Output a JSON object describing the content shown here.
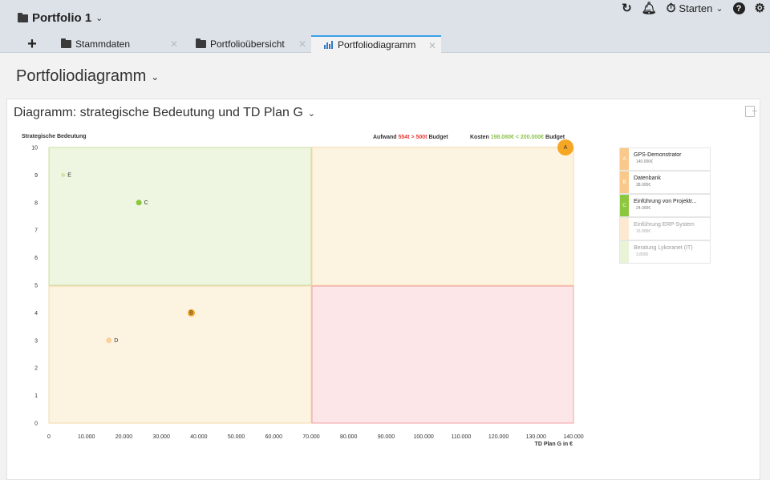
{
  "header": {
    "portfolio_title": "Portfolio 1",
    "starten_label": "Starten",
    "icons": [
      "refresh-icon",
      "bell-icon",
      "stopwatch-icon",
      "help-icon",
      "gear-icon"
    ]
  },
  "tabs": [
    {
      "label": "Stammdaten",
      "icon": "folder-icon",
      "active": false
    },
    {
      "label": "Portfolioübersicht",
      "icon": "folder-icon",
      "active": false
    },
    {
      "label": "Portfoliodiagramm",
      "icon": "chart-icon",
      "active": true
    }
  ],
  "page": {
    "title": "Portfoliodiagramm"
  },
  "card": {
    "title": "Diagramm: strategische Bedeutung und TD Plan G"
  },
  "budget": {
    "aufwand_label": "Aufwand",
    "aufwand_value": "554t > 500t",
    "aufwand_suffix": "Budget",
    "kosten_label": "Kosten",
    "kosten_value": "198.080€ < 200.000€",
    "kosten_suffix": "Budget",
    "colors": {
      "over": "#e53935",
      "under": "#8bc34a"
    }
  },
  "chart_data": {
    "type": "scatter",
    "xlabel": "TD Plan G in €",
    "ylabel": "Strategische Bedeutung",
    "xlim": [
      0,
      140000
    ],
    "ylim": [
      0,
      10
    ],
    "x_ticks": [
      "0",
      "10.000",
      "20.000",
      "30.000",
      "40.000",
      "50.000",
      "60.000",
      "70.000",
      "80.000",
      "90.000",
      "100.000",
      "110.000",
      "120.000",
      "130.000",
      "140.000"
    ],
    "y_ticks": [
      "0",
      "1",
      "2",
      "3",
      "4",
      "5",
      "6",
      "7",
      "8",
      "9",
      "10"
    ],
    "quadrants": [
      {
        "name": "top-left",
        "color": "#eef5e0",
        "border": "#c9dfa6"
      },
      {
        "name": "top-right",
        "color": "#fdf3e1",
        "border": "#f5d9a8"
      },
      {
        "name": "bottom-left",
        "color": "#fdf3e1",
        "border": "#f5d9a8"
      },
      {
        "name": "bottom-right",
        "color": "#fde6e7",
        "border": "#f0a0a6"
      }
    ],
    "points": [
      {
        "x": 140000,
        "y": 10,
        "label": "A",
        "color": "#f5a623",
        "size": "large"
      },
      {
        "x": 38000,
        "y": 4,
        "label": "B",
        "color": "#f5a623",
        "size": "medium"
      },
      {
        "x": 24000,
        "y": 8,
        "label": "C",
        "color": "#8dc63f",
        "size": "small"
      },
      {
        "x": 16000,
        "y": 3,
        "label": "D",
        "color": "#f8d19b",
        "size": "small"
      },
      {
        "x": 3800,
        "y": 9,
        "label": "E",
        "color": "#cfe6a3",
        "size": "tiny"
      }
    ]
  },
  "legend": [
    {
      "letter": "A",
      "name": "GPS-Demonstrator",
      "value": "140.000€",
      "color": "#f8c98a",
      "muted": false
    },
    {
      "letter": "B",
      "name": "Datenbank",
      "value": "38.000€",
      "color": "#f8c98a",
      "muted": false
    },
    {
      "letter": "C",
      "name": "Einführung von Projektr...",
      "value": "24.000€",
      "color": "#8dc63f",
      "muted": false
    },
    {
      "letter": "",
      "name": "Einführung ERP-System",
      "value": "16.000€",
      "color": "#fde9d1",
      "muted": true
    },
    {
      "letter": "",
      "name": "Beratung Lykoranet (IT)",
      "value": "3.800€",
      "color": "#e8f3d8",
      "muted": true
    }
  ]
}
